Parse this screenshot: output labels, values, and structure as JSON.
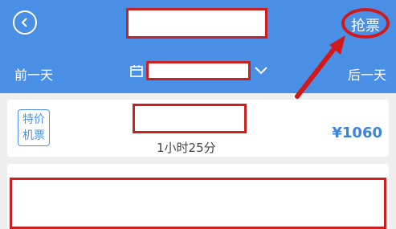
{
  "header": {
    "grab_label": "抢票",
    "back_icon": "chevron-left-icon"
  },
  "date_nav": {
    "prev_label": "前一天",
    "next_label": "后一天",
    "calendar_icon": "calendar-icon",
    "dropdown_icon": "chevron-down-icon"
  },
  "flight": {
    "badge_line1": "特价",
    "badge_line2": "机票",
    "duration": "1小时25分",
    "price": "¥1060"
  },
  "colors": {
    "header_bg": "#4a8fe6",
    "highlight_red": "#cc1f1f",
    "price_blue": "#3a84d9"
  }
}
